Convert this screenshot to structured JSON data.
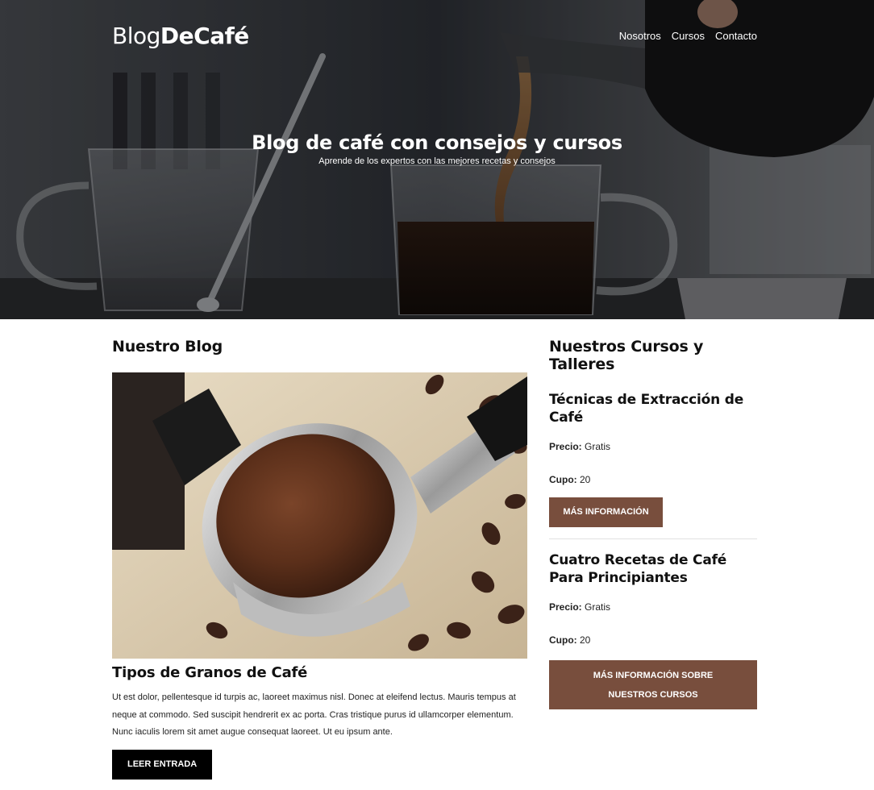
{
  "header": {
    "logo": {
      "light": "Blog",
      "bold": "DeCafé"
    },
    "nav": [
      "Nosotros",
      "Cursos",
      "Contacto"
    ]
  },
  "hero": {
    "title": "Blog de café con consejos y cursos",
    "subtitle": "Aprende de los expertos con las mejores recetas y consejos"
  },
  "blog": {
    "section_title": "Nuestro Blog",
    "post": {
      "title": "Tipos de Granos de Café",
      "text": "Ut est dolor, pellentesque id turpis ac, laoreet maximus nisl. Donec at eleifend lectus. Mauris tempus at neque at commodo. Sed suscipit hendrerit ex ac porta. Cras tristique purus id ullamcorper elementum. Nunc iaculis lorem sit amet augue consequat laoreet. Ut eu ipsum ante.",
      "button": "Leer Entrada"
    }
  },
  "courses": {
    "section_title": "Nuestros Cursos y Talleres",
    "items": [
      {
        "title": "Técnicas de Extracción de Café",
        "price_label": "Precio:",
        "price": "Gratis",
        "quota_label": "Cupo:",
        "quota": "20",
        "button": "Más Información"
      },
      {
        "title": "Cuatro Recetas de Café Para Principiantes",
        "price_label": "Precio:",
        "price": "Gratis",
        "quota_label": "Cupo:",
        "quota": "20"
      }
    ],
    "more_button": "Más Información Sobre Nuestros Cursos"
  },
  "colors": {
    "accent": "#784e3d",
    "button_dark": "#000000",
    "hero_overlay": "#2b2d33"
  }
}
